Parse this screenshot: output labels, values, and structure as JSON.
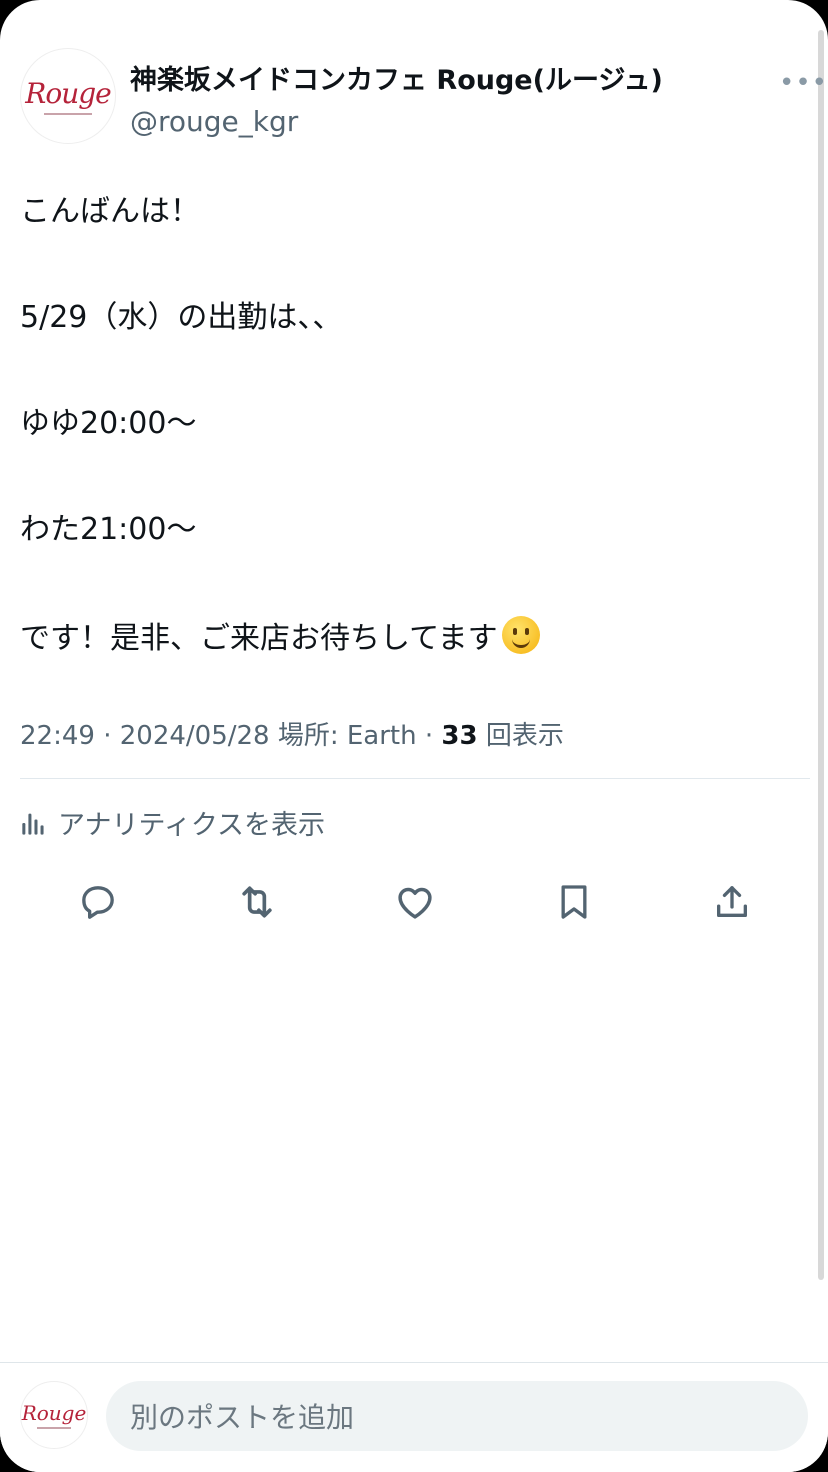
{
  "author": {
    "display_name": "神楽坂メイドコンカフェ Rouge(ルージュ)",
    "handle": "@rouge_kgr",
    "avatar_text": "Rouge"
  },
  "tweet": {
    "paragraphs": [
      "こんばんは！",
      "5/29（水）の出勤は、、",
      "ゆゆ20:00〜",
      "わた21:00〜",
      "です！是非、ご来店お待ちしてます"
    ],
    "emoji": "slightly-smiling-face",
    "time": "22:49",
    "date": "2024/05/28",
    "location": "場所: Earth",
    "views_count": "33",
    "views_label": "回表示"
  },
  "analytics_label": "アナリティクスを表示",
  "actions": [
    "reply-icon",
    "retweet-icon",
    "like-icon",
    "bookmark-icon",
    "share-icon"
  ],
  "reply": {
    "placeholder": "別のポストを追加",
    "avatar_text": "Rouge"
  },
  "colors": {
    "text_primary": "#0f1419",
    "text_secondary": "#536471",
    "brand_logo": "#b5233a"
  }
}
